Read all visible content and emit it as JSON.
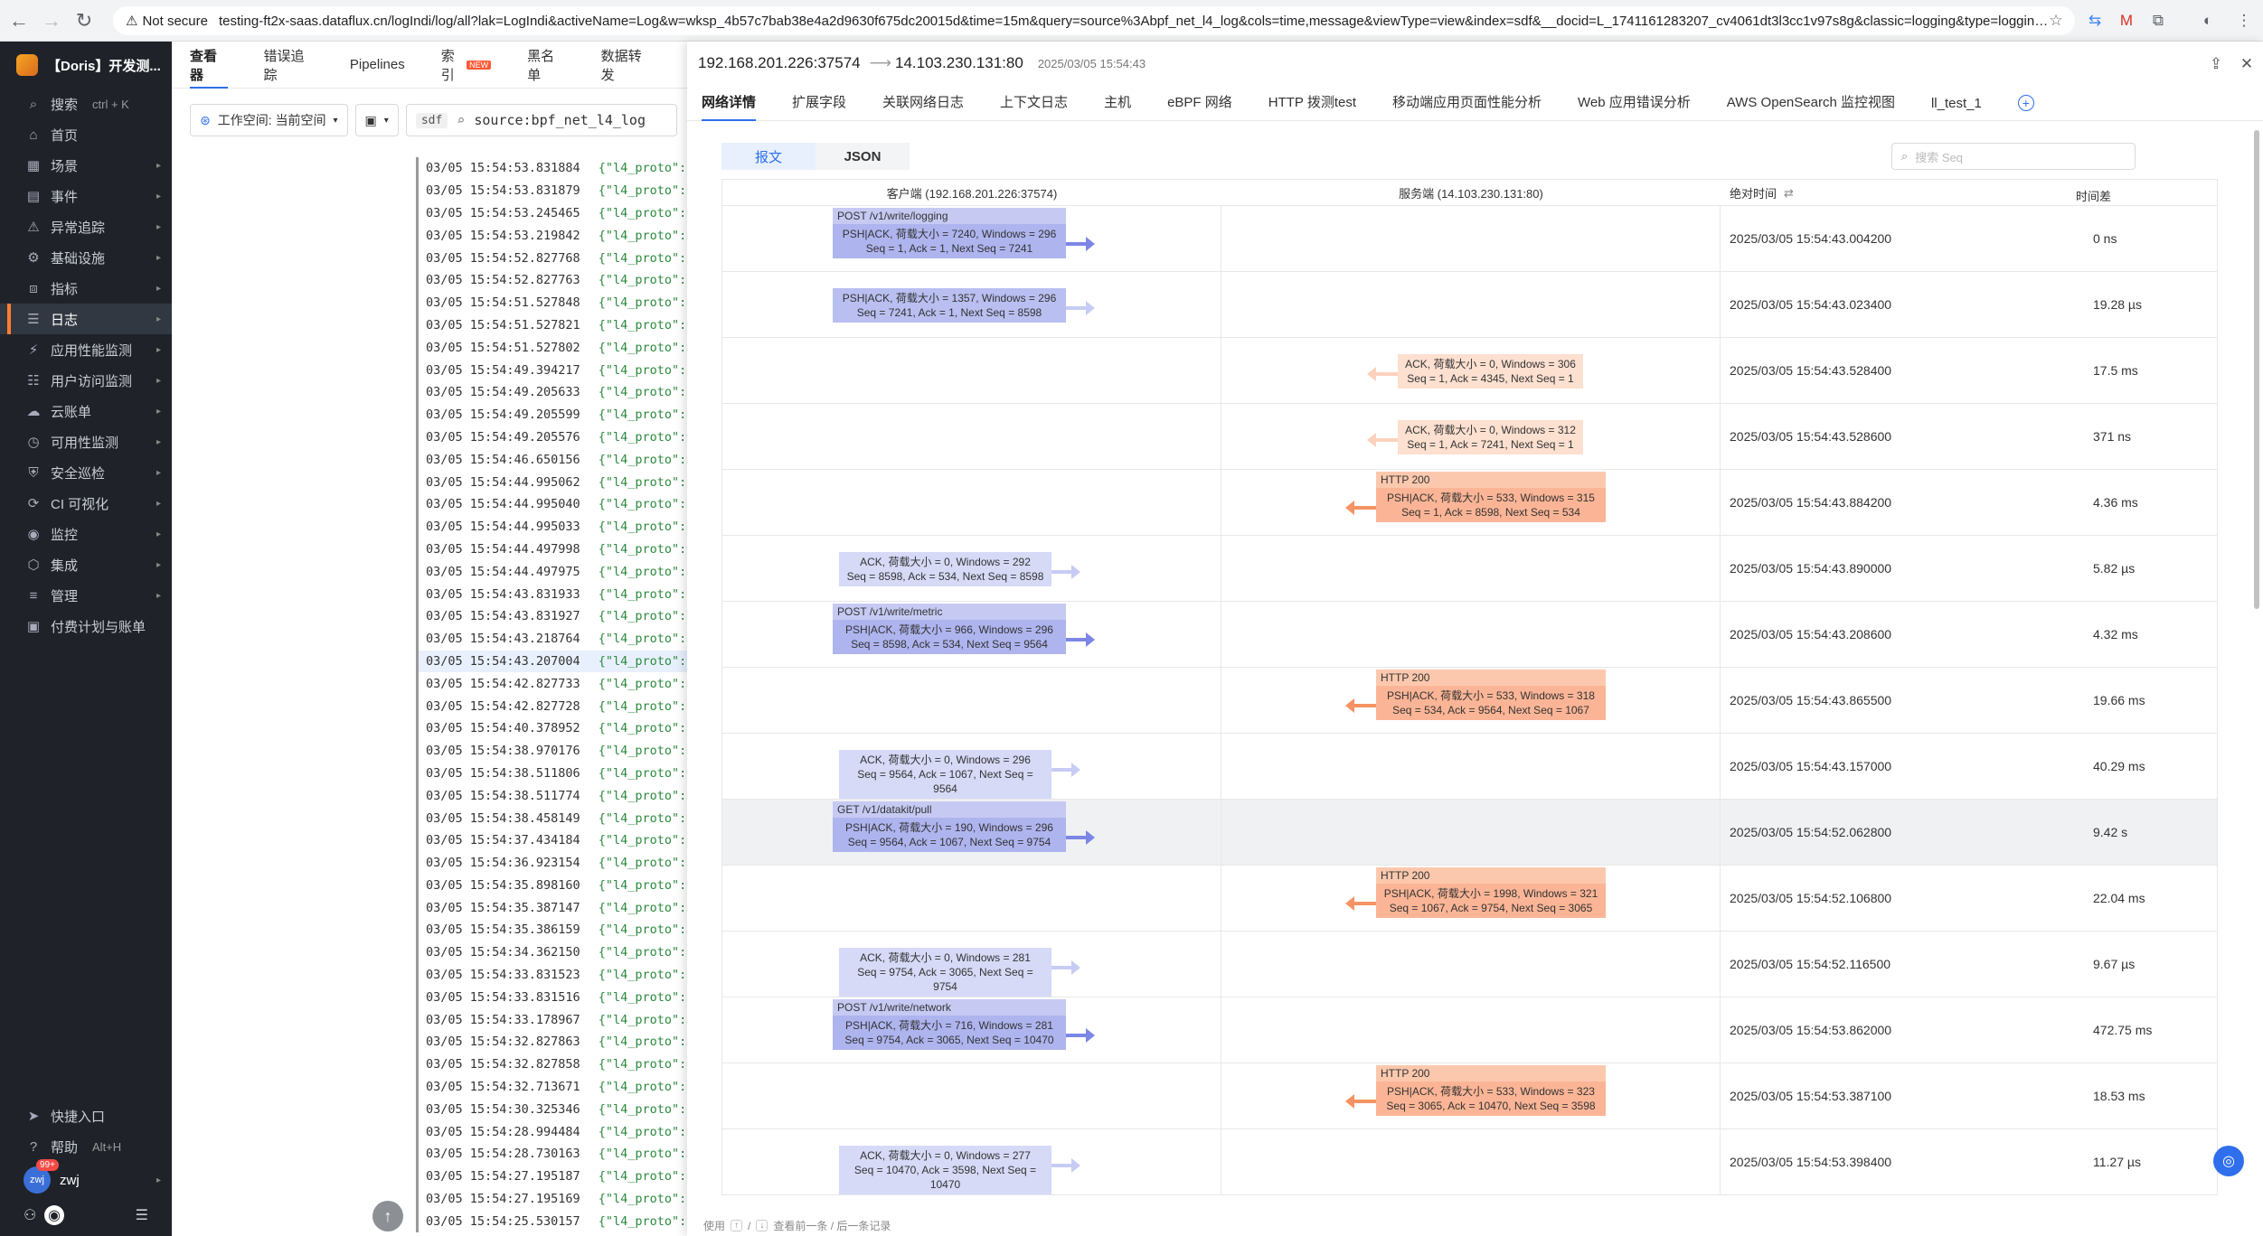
{
  "browser": {
    "security": "Not secure",
    "url": "testing-ft2x-saas.dataflux.cn/logIndi/log/all?lak=LogIndi&activeName=Log&w=wksp_4b57c7bab38e4a2d9630f675dc20015d&time=15m&query=source%3Abpf_net_l4_log&cols=time,message&viewType=view&index=sdf&__docid=L_1741161283207_cv4061dt3l3cc1v97s8g&classic=logging&type=logging&doc_time=..."
  },
  "sidebar": {
    "workspace": "【Doris】开发测...",
    "search_label": "搜索",
    "search_kbd": "ctrl + K",
    "items": [
      {
        "label": "首页",
        "icon": "home-icon",
        "arrow": false
      },
      {
        "label": "场景",
        "icon": "scene-icon",
        "arrow": true
      },
      {
        "label": "事件",
        "icon": "event-icon",
        "arrow": true
      },
      {
        "label": "异常追踪",
        "icon": "issue-icon",
        "arrow": true
      },
      {
        "label": "基础设施",
        "icon": "infra-icon",
        "arrow": true
      },
      {
        "label": "指标",
        "icon": "metric-icon",
        "arrow": true
      },
      {
        "label": "日志",
        "icon": "log-icon",
        "arrow": true,
        "active": true
      },
      {
        "label": "应用性能监测",
        "icon": "apm-icon",
        "arrow": true
      },
      {
        "label": "用户访问监测",
        "icon": "rum-icon",
        "arrow": true
      },
      {
        "label": "云账单",
        "icon": "bill-icon",
        "arrow": true
      },
      {
        "label": "可用性监测",
        "icon": "dial-icon",
        "arrow": true
      },
      {
        "label": "安全巡检",
        "icon": "security-icon",
        "arrow": true
      },
      {
        "label": "CI 可视化",
        "icon": "ci-icon",
        "arrow": true
      },
      {
        "label": "监控",
        "icon": "monitor-icon",
        "arrow": true
      },
      {
        "label": "集成",
        "icon": "integration-icon",
        "arrow": true
      },
      {
        "label": "管理",
        "icon": "manage-icon",
        "arrow": true
      },
      {
        "label": "付费计划与账单",
        "icon": "plan-icon",
        "arrow": false
      }
    ],
    "shortcut": "快捷入口",
    "help": "帮助",
    "help_kbd": "Alt+H",
    "user": "zwj",
    "user_badge": "99+"
  },
  "explorer": {
    "tabs": [
      "查看器",
      "错误追踪",
      "Pipelines",
      "索引",
      "黑名单",
      "数据转发"
    ],
    "new_tag": "NEW",
    "workspace_select": "工作空间: 当前空间",
    "index_tag": "sdf",
    "query": "source:bpf_net_l4_log",
    "log_value": "{\"l4_proto\":\"",
    "logs": [
      "03/05 15:54:53.831884",
      "03/05 15:54:53.831879",
      "03/05 15:54:53.245465",
      "03/05 15:54:53.219842",
      "03/05 15:54:52.827768",
      "03/05 15:54:52.827763",
      "03/05 15:54:51.527848",
      "03/05 15:54:51.527821",
      "03/05 15:54:51.527802",
      "03/05 15:54:49.394217",
      "03/05 15:54:49.205633",
      "03/05 15:54:49.205599",
      "03/05 15:54:49.205576",
      "03/05 15:54:46.650156",
      "03/05 15:54:44.995062",
      "03/05 15:54:44.995040",
      "03/05 15:54:44.995033",
      "03/05 15:54:44.497998",
      "03/05 15:54:44.497975",
      "03/05 15:54:43.831933",
      "03/05 15:54:43.831927",
      "03/05 15:54:43.218764",
      "03/05 15:54:43.207004",
      "03/05 15:54:42.827733",
      "03/05 15:54:42.827728",
      "03/05 15:54:40.378952",
      "03/05 15:54:38.970176",
      "03/05 15:54:38.511806",
      "03/05 15:54:38.511774",
      "03/05 15:54:38.458149",
      "03/05 15:54:37.434184",
      "03/05 15:54:36.923154",
      "03/05 15:54:35.898160",
      "03/05 15:54:35.387147",
      "03/05 15:54:35.386159",
      "03/05 15:54:34.362150",
      "03/05 15:54:33.831523",
      "03/05 15:54:33.831516",
      "03/05 15:54:33.178967",
      "03/05 15:54:32.827863",
      "03/05 15:54:32.827858",
      "03/05 15:54:32.713671",
      "03/05 15:54:30.325346",
      "03/05 15:54:28.994484",
      "03/05 15:54:28.730163",
      "03/05 15:54:27.195187",
      "03/05 15:54:27.195169",
      "03/05 15:54:25.530157"
    ],
    "selected_index": 22
  },
  "drawer": {
    "source": "192.168.201.226:37574",
    "dest": "14.103.230.131:80",
    "time": "2025/03/05 15:54:43",
    "tabs": [
      "网络详情",
      "扩展字段",
      "关联网络日志",
      "上下文日志",
      "主机",
      "eBPF 网络",
      "HTTP 拨测test",
      "移动端应用页面性能分析",
      "Web 应用错误分析",
      "AWS OpenSearch 监控视图",
      "ll_test_1"
    ],
    "seg": [
      "报文",
      "JSON"
    ],
    "seq_placeholder": "搜索 Seq",
    "col_client": "客户端 (192.168.201.226:37574)",
    "col_server": "服务端 (14.103.230.131:80)",
    "col_time": "绝对时间",
    "col_diff": "时间差",
    "footer_use": "使用",
    "footer_keys": [
      "↑",
      "/",
      "↓"
    ],
    "footer_hint": "查看前一条 / 后一条记录",
    "rows": [
      {
        "dir": "c",
        "kind": "req",
        "label": "POST /v1/write/logging",
        "l1": "PSH|ACK, 荷载大小 = 7240, Windows = 296",
        "l2": "Seq = 1, Ack = 1, Next Seq = 7241",
        "time": "2025/03/05 15:54:43.004200",
        "diff": "0 ns"
      },
      {
        "dir": "c",
        "kind": "req",
        "label": "",
        "l1": "PSH|ACK, 荷载大小 = 1357, Windows = 296",
        "l2": "Seq = 7241, Ack = 1, Next Seq = 8598",
        "time": "2025/03/05 15:54:43.023400",
        "diff": "19.28 µs"
      },
      {
        "dir": "s",
        "kind": "rack",
        "label": "",
        "l1": "ACK, 荷载大小 = 0, Windows = 306",
        "l2": "Seq = 1, Ack = 4345, Next Seq = 1",
        "time": "2025/03/05 15:54:43.528400",
        "diff": "17.5 ms"
      },
      {
        "dir": "s",
        "kind": "rack",
        "label": "",
        "l1": "ACK, 荷载大小 = 0, Windows = 312",
        "l2": "Seq = 1, Ack = 7241, Next Seq = 1",
        "time": "2025/03/05 15:54:43.528600",
        "diff": "371 ns"
      },
      {
        "dir": "s",
        "kind": "resp",
        "label": "HTTP 200",
        "l1": "PSH|ACK, 荷载大小 = 533, Windows = 315",
        "l2": "Seq = 1, Ack = 8598, Next Seq = 534",
        "time": "2025/03/05 15:54:43.884200",
        "diff": "4.36 ms"
      },
      {
        "dir": "c",
        "kind": "ack",
        "label": "",
        "l1": "ACK, 荷载大小 = 0, Windows = 292",
        "l2": "Seq = 8598, Ack = 534, Next Seq = 8598",
        "time": "2025/03/05 15:54:43.890000",
        "diff": "5.82 µs"
      },
      {
        "dir": "c",
        "kind": "req",
        "label": "POST /v1/write/metric",
        "l1": "PSH|ACK, 荷载大小 = 966, Windows = 296",
        "l2": "Seq = 8598, Ack = 534, Next Seq = 9564",
        "time": "2025/03/05 15:54:43.208600",
        "diff": "4.32 ms"
      },
      {
        "dir": "s",
        "kind": "resp",
        "label": "HTTP 200",
        "l1": "PSH|ACK, 荷载大小 = 533, Windows = 318",
        "l2": "Seq = 534, Ack = 9564, Next Seq = 1067",
        "time": "2025/03/05 15:54:43.865500",
        "diff": "19.66 ms"
      },
      {
        "dir": "c",
        "kind": "ack",
        "label": "",
        "l1": "ACK, 荷载大小 = 0, Windows = 296",
        "l2": "Seq = 9564, Ack = 1067, Next Seq = 9564",
        "time": "2025/03/05 15:54:43.157000",
        "diff": "40.29 ms"
      },
      {
        "dir": "c",
        "kind": "req",
        "label": "GET /v1/datakit/pull",
        "l1": "PSH|ACK, 荷载大小 = 190, Windows = 296",
        "l2": "Seq = 9564, Ack = 1067, Next Seq = 9754",
        "time": "2025/03/05 15:54:52.062800",
        "diff": "9.42 s",
        "hl": true
      },
      {
        "dir": "s",
        "kind": "resp",
        "label": "HTTP 200",
        "l1": "PSH|ACK, 荷载大小 = 1998, Windows = 321",
        "l2": "Seq = 1067, Ack = 9754, Next Seq = 3065",
        "time": "2025/03/05 15:54:52.106800",
        "diff": "22.04 ms"
      },
      {
        "dir": "c",
        "kind": "ack",
        "label": "",
        "l1": "ACK, 荷载大小 = 0, Windows = 281",
        "l2": "Seq = 9754, Ack = 3065, Next Seq = 9754",
        "time": "2025/03/05 15:54:52.116500",
        "diff": "9.67 µs"
      },
      {
        "dir": "c",
        "kind": "req",
        "label": "POST /v1/write/network",
        "l1": "PSH|ACK, 荷载大小 = 716, Windows = 281",
        "l2": "Seq = 9754, Ack = 3065, Next Seq = 10470",
        "time": "2025/03/05 15:54:53.862000",
        "diff": "472.75 ms"
      },
      {
        "dir": "s",
        "kind": "resp",
        "label": "HTTP 200",
        "l1": "PSH|ACK, 荷载大小 = 533, Windows = 323",
        "l2": "Seq = 3065, Ack = 10470, Next Seq = 3598",
        "time": "2025/03/05 15:54:53.387100",
        "diff": "18.53 ms"
      },
      {
        "dir": "c",
        "kind": "ack",
        "label": "",
        "l1": "ACK, 荷载大小 = 0, Windows = 277",
        "l2": "Seq = 10470, Ack = 3598, Next Seq = 10470",
        "time": "2025/03/05 15:54:53.398400",
        "diff": "11.27 µs"
      }
    ]
  }
}
